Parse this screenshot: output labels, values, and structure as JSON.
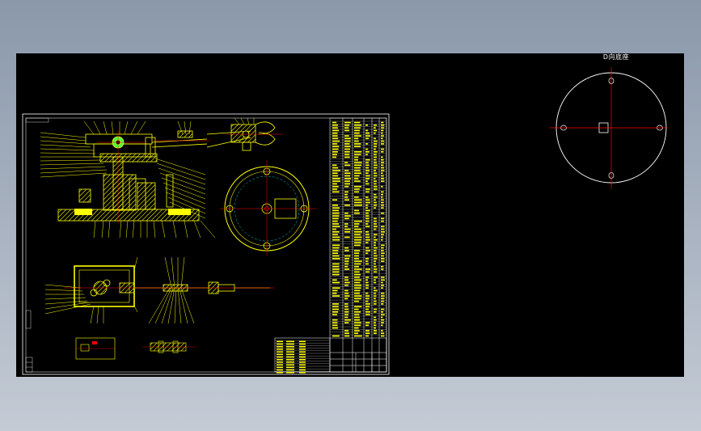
{
  "drawing": {
    "view_label": "D向底座",
    "sheet_tag": "",
    "colors": {
      "background": "#000000",
      "frame": "#ffffff",
      "geometry": "#ffff00",
      "centerline": "#ff0000",
      "hidden": "#00ffff",
      "hatch": "#ffff00",
      "circle_view": "#ffffff"
    }
  }
}
